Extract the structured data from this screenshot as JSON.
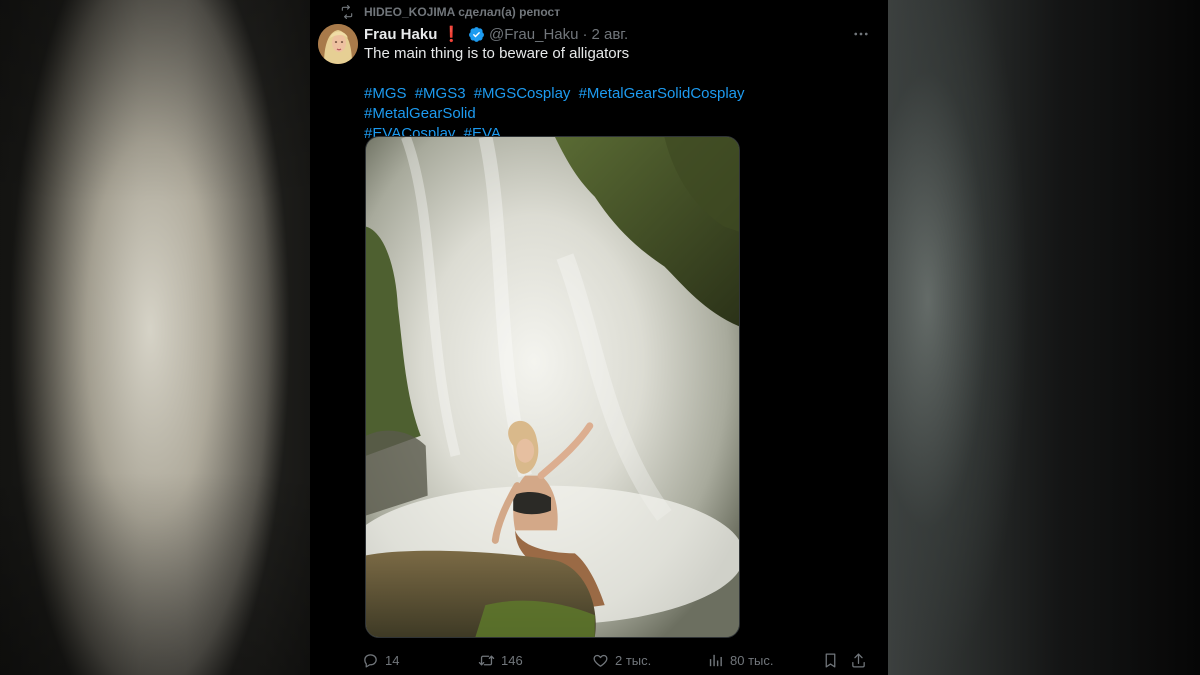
{
  "repost": {
    "text": "HIDEO_KOJIMA сделал(а) репост",
    "icon": "repost-icon"
  },
  "author": {
    "display_name": "Frau Haku",
    "badge_emoji": "❗",
    "handle": "@Frau_Haku",
    "separator": "·",
    "time": "2 авг.",
    "verified_color": "#1d9bf0"
  },
  "tweet": {
    "text": "The main thing is to beware of alligators",
    "hashtags": [
      "#MGS",
      "#MGS3",
      "#MGSCosplay",
      "#MetalGearSolidCosplay",
      "#MetalGearSolid",
      "#EVACosplay",
      "#EVA"
    ],
    "hashtag_color": "#1d9bf0"
  },
  "media": {
    "icon": "photo-waterfall-cosplay"
  },
  "actions": {
    "replies": "14",
    "retweets": "146",
    "likes": "2 тыс.",
    "views": "80 тыс."
  },
  "colors": {
    "background": "#000000",
    "text": "#e7e9ea",
    "muted": "#71767b",
    "accent": "#1d9bf0",
    "alert": "#f4212e"
  }
}
